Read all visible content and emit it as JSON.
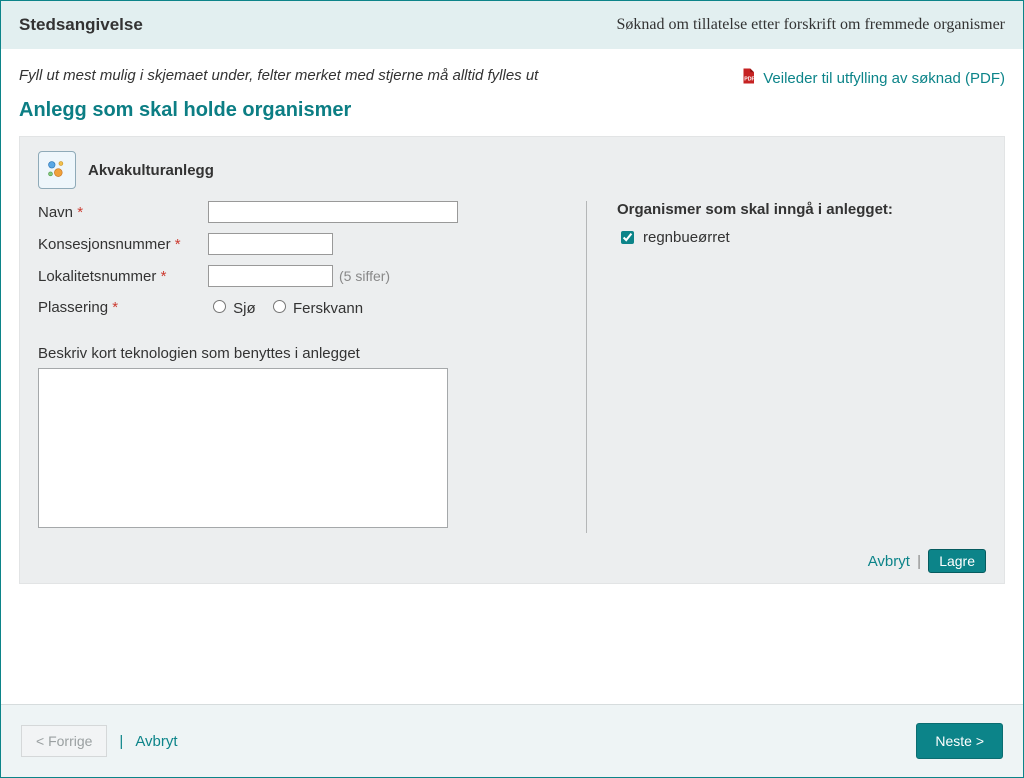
{
  "header": {
    "left": "Stedsangivelse",
    "right": "Søknad om tillatelse etter forskrift om fremmede organismer"
  },
  "instruction": "Fyll ut mest mulig i skjemaet under, felter merket med stjerne må alltid fylles ut",
  "pdf_link_label": "Veileder til utfylling av søknad (PDF)",
  "section_title": "Anlegg som skal holde organismer",
  "panel": {
    "title": "Akvakulturanlegg",
    "fields": {
      "name_label": "Navn",
      "license_label": "Konsesjonsnummer",
      "locality_label": "Lokalitetsnummer",
      "locality_hint": "(5 siffer)",
      "placement_label": "Plassering",
      "placement_options": {
        "sea": "Sjø",
        "fresh": "Ferskvann"
      },
      "desc_label": "Beskriv kort teknologien som benyttes i anlegget"
    },
    "organisms": {
      "title": "Organismer som skal inngå i anlegget:",
      "items": [
        {
          "label": "regnbueørret",
          "checked": true
        }
      ]
    },
    "actions": {
      "cancel": "Avbryt",
      "save": "Lagre"
    }
  },
  "footer": {
    "prev": "< Forrige",
    "cancel": "Avbryt",
    "next": "Neste >"
  }
}
